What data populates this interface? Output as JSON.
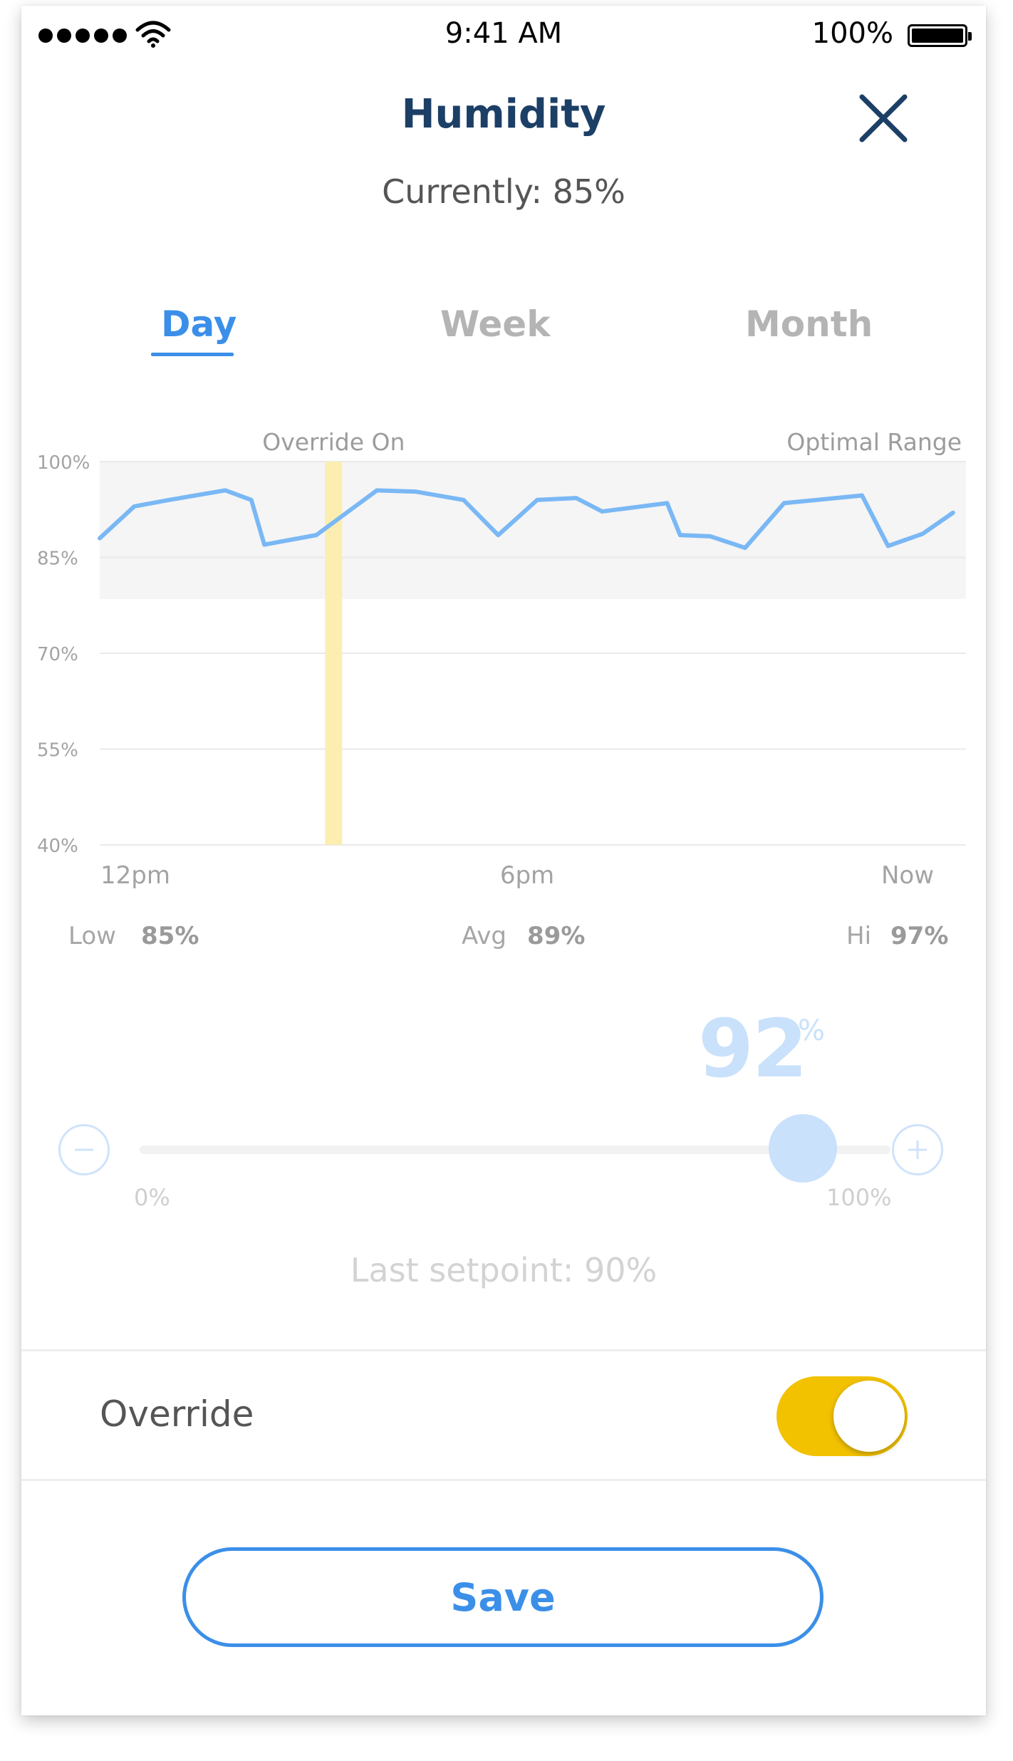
{
  "status_bar": {
    "time": "9:41 AM",
    "battery": "100%"
  },
  "header": {
    "title": "Humidity",
    "subtitle": "Currently: 85%"
  },
  "tabs": [
    {
      "label": "Day",
      "active": true
    },
    {
      "label": "Week",
      "active": false
    },
    {
      "label": "Month",
      "active": false
    }
  ],
  "chart_data": {
    "type": "line",
    "title": "",
    "xlabel": "",
    "ylabel": "",
    "ylim": [
      40,
      100
    ],
    "y_ticks": [
      "100%",
      "85%",
      "70%",
      "55%",
      "40%"
    ],
    "y_tick_values": [
      100,
      85,
      70,
      55,
      40
    ],
    "x_tick_labels": [
      "12pm",
      "6pm",
      "Now"
    ],
    "x_range": [
      0,
      1
    ],
    "optimal_range": {
      "label": "Optimal Range",
      "y_min": 78.5,
      "y_max": 100
    },
    "override_marker": {
      "label": "Override On",
      "x": 0.27
    },
    "series": [
      {
        "x": [
          0,
          0.04,
          0.08,
          0.145,
          0.175,
          0.19,
          0.25,
          0.32,
          0.365,
          0.42,
          0.46,
          0.505,
          0.55,
          0.58,
          0.655,
          0.67,
          0.705,
          0.745,
          0.79,
          0.88,
          0.91,
          0.95,
          0.985
        ],
        "y": [
          88,
          93,
          94,
          95.5,
          94,
          87,
          88.5,
          95.5,
          95.3,
          94,
          88.5,
          94,
          94.3,
          92.2,
          93.5,
          88.5,
          88.3,
          86.5,
          93.5,
          94.7,
          86.8,
          88.7,
          92
        ]
      }
    ],
    "colors": {
      "line": "#7ab8f5",
      "optimal_band": "#f5f5f5",
      "override_bar": "#fbeeb0",
      "grid": "#e9e9e9"
    }
  },
  "stats": {
    "low_label": "Low",
    "low_value": "85%",
    "avg_label": "Avg",
    "avg_value": "89%",
    "hi_label": "Hi",
    "hi_value": "97%"
  },
  "setpoint": {
    "value": "92",
    "unit": "%",
    "level": 0.92,
    "min_label": "0%",
    "max_label": "100%",
    "last": "Last setpoint: 90%",
    "decrease_icon": "minus-icon",
    "increase_icon": "plus-icon"
  },
  "override": {
    "label": "Override",
    "enabled": true
  },
  "save_label": "Save",
  "colors": {
    "accent": "#3b8fe8",
    "title": "#1c3f66",
    "toggle_on": "#f2c200"
  }
}
